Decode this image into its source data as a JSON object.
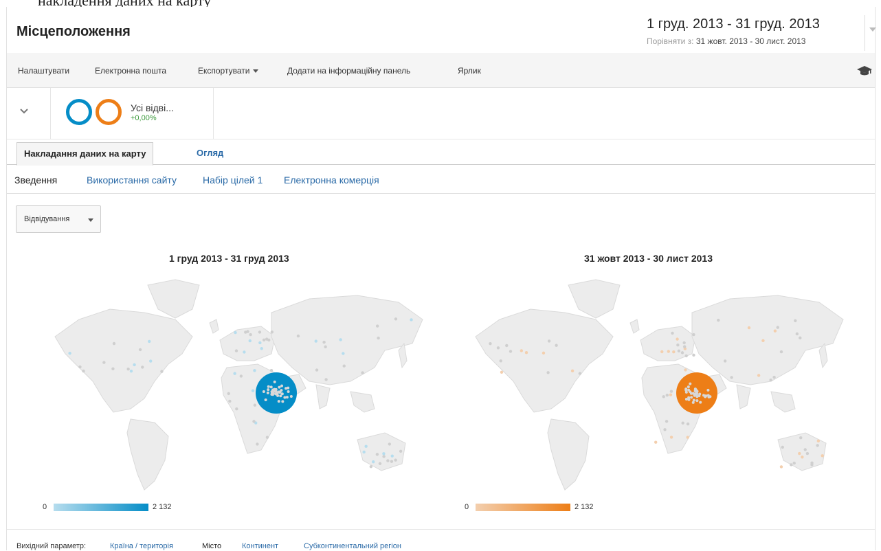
{
  "caption_clipped": "накладення даних на карту",
  "header": {
    "title": "Місцеположення",
    "date_range": "1 груд. 2013 - 31 груд. 2013",
    "compare_label": "Порівняти з:",
    "compare_range": "31 жовт. 2013 - 30 лист. 2013"
  },
  "toolbar": {
    "items": [
      "Налаштувати",
      "Електронна пошта",
      "Експортувати",
      "Додати на інформаційну панель",
      "Ярлик"
    ]
  },
  "segment": {
    "name": "Усі відві...",
    "change": "+0,00%"
  },
  "tabs": [
    "Накладання даних на карту",
    "Огляд"
  ],
  "subtabs": [
    "Зведення",
    "Використання сайту",
    "Набір цілей 1",
    "Електронна комерція"
  ],
  "metric": {
    "selected": "Відвідування"
  },
  "maps": [
    {
      "title": "1 груд 2013 - 31 груд 2013",
      "legend_min": "0",
      "legend_max": "2 132",
      "color": "#058dc7",
      "light": "#b6ddee"
    },
    {
      "title": "31 жовт 2013 - 30 лист 2013",
      "legend_min": "0",
      "legend_max": "2 132",
      "color": "#ed7e17",
      "light": "#f3cfae"
    }
  ],
  "footer": {
    "label": "Вихідний параметр:",
    "items": [
      "Країна / територія",
      "Місто",
      "Континент",
      "Субконтинентальний регіон"
    ]
  },
  "colors": {
    "link": "#2a6aa7",
    "positive": "#3c9a3c"
  }
}
